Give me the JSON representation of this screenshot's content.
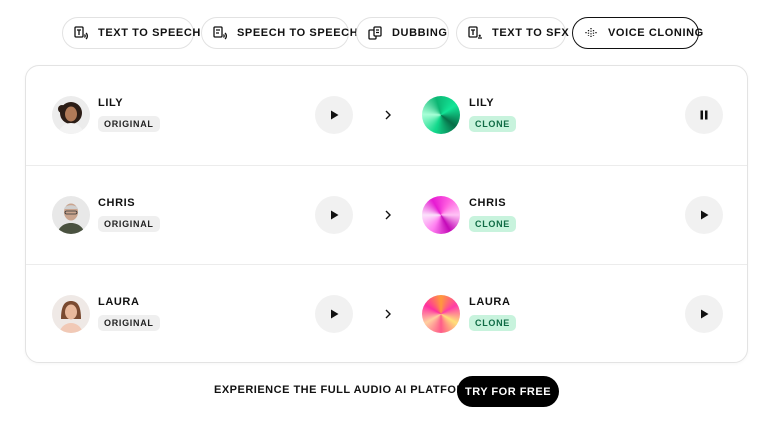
{
  "tabs": [
    {
      "label": "TEXT TO SPEECH",
      "icon": "text-to-speech-icon"
    },
    {
      "label": "SPEECH TO SPEECH",
      "icon": "speech-to-speech-icon"
    },
    {
      "label": "DUBBING",
      "icon": "dubbing-icon"
    },
    {
      "label": "TEXT TO SFX",
      "icon": "text-to-sfx-icon"
    },
    {
      "label": "VOICE CLONING",
      "icon": "voice-cloning-icon",
      "active": true
    }
  ],
  "rows": [
    {
      "original": {
        "name": "LILY",
        "tag": "ORIGINAL"
      },
      "clone": {
        "name": "LILY",
        "tag": "CLONE",
        "state": "playing"
      }
    },
    {
      "original": {
        "name": "CHRIS",
        "tag": "ORIGINAL"
      },
      "clone": {
        "name": "CHRIS",
        "tag": "CLONE",
        "state": "paused"
      }
    },
    {
      "original": {
        "name": "LAURA",
        "tag": "ORIGINAL"
      },
      "clone": {
        "name": "LAURA",
        "tag": "CLONE",
        "state": "paused"
      }
    }
  ],
  "cta": {
    "text": "EXPERIENCE THE FULL AUDIO AI PLATFORM",
    "button": "TRY FOR FREE"
  },
  "colors": {
    "clone_tag_bg": "#c8f3dd",
    "clone_tag_text": "#0f6b45",
    "cta_bg": "#000000"
  }
}
